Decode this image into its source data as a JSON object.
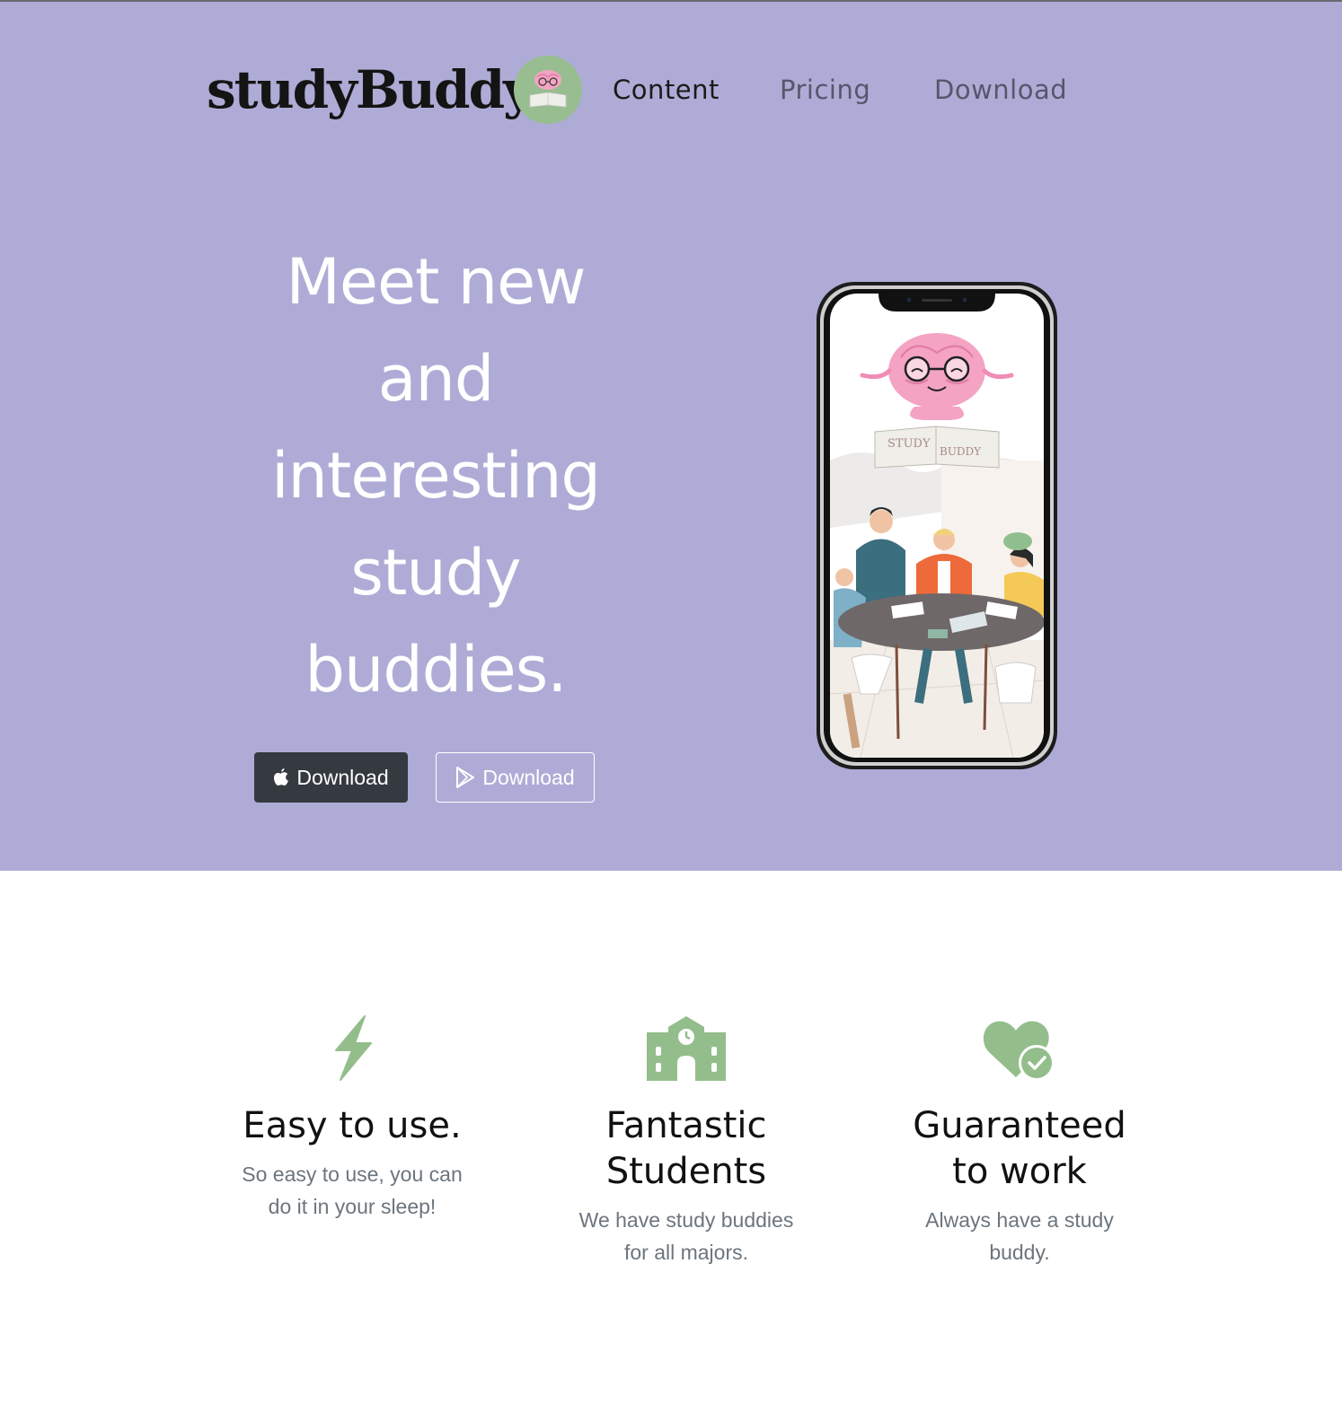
{
  "nav": {
    "brand": "studyBuddy",
    "links": [
      {
        "label": "Content",
        "active": true
      },
      {
        "label": "Pricing",
        "active": false
      },
      {
        "label": "Download",
        "active": false
      }
    ]
  },
  "hero": {
    "headline_lines": [
      "Meet new",
      "and",
      "interesting",
      "study",
      "buddies."
    ],
    "buttons": [
      {
        "label": "Download",
        "icon": "apple-icon",
        "style": "dark"
      },
      {
        "label": "Download",
        "icon": "google-play-icon",
        "style": "outline"
      }
    ],
    "phone_book_labels": [
      "STUDY",
      "BUDDY"
    ]
  },
  "features": [
    {
      "icon": "bolt-icon",
      "title": "Easy to use.",
      "body_lines": [
        "So easy to use, you can",
        "do it in your sleep!"
      ]
    },
    {
      "icon": "school-icon",
      "title_lines": [
        "Fantastic",
        "Students"
      ],
      "body_lines": [
        "We have study buddies",
        "for all majors."
      ]
    },
    {
      "icon": "heart-check-icon",
      "title_lines": [
        "Guaranteed",
        "to work"
      ],
      "body_lines": [
        "Always have a study",
        "buddy."
      ]
    }
  ],
  "colors": {
    "hero_bg": "#aeacd6",
    "accent_green": "#94bd8c",
    "dark_button": "#343a40",
    "muted_text": "#6c757d"
  }
}
